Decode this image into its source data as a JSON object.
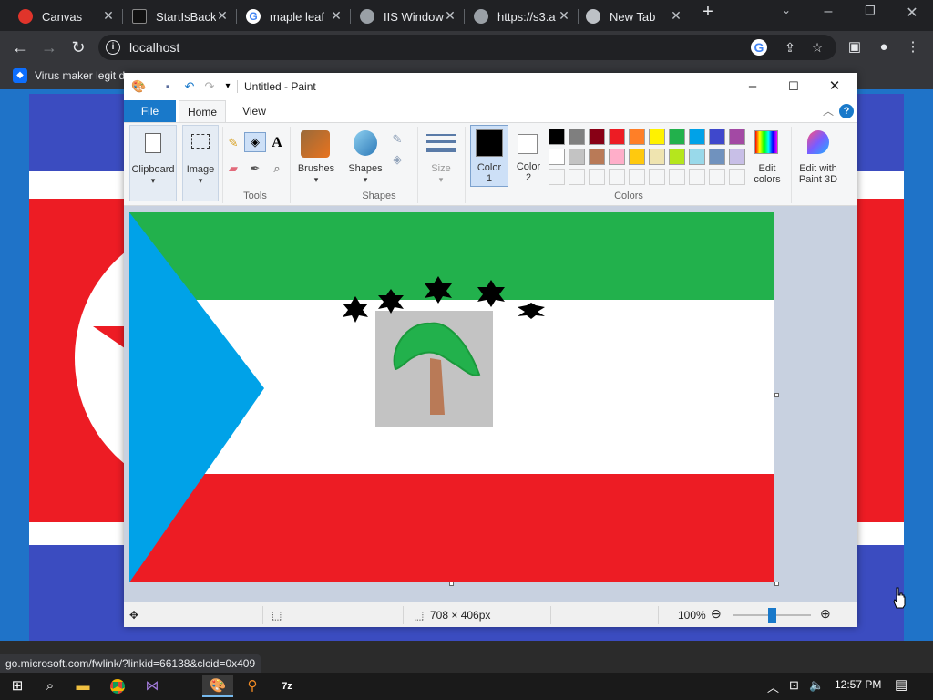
{
  "browser": {
    "tabs": [
      {
        "title": "Canvas",
        "icon": "canvas-icon"
      },
      {
        "title": "StartIsBack",
        "icon": "startisback-icon"
      },
      {
        "title": "maple leaf",
        "icon": "google-icon"
      },
      {
        "title": "IIS Window",
        "icon": "globe-icon"
      },
      {
        "title": "https://s3.a",
        "icon": "globe-icon"
      },
      {
        "title": "New Tab",
        "icon": "chrome-icon"
      }
    ],
    "new_tab": "+",
    "url": "localhost",
    "bookmark": "Virus maker legit d",
    "status_url": "go.microsoft.com/fwlink/?linkid=66138&clcid=0x409"
  },
  "paint": {
    "title": "Untitled - Paint",
    "tabs": {
      "file": "File",
      "home": "Home",
      "view": "View"
    },
    "ribbon": {
      "clipboard": "Clipboard",
      "image": "Image",
      "tools": "Tools",
      "brushes": "Brushes",
      "shapes": "Shapes",
      "shapes_group": "Shapes",
      "size": "Size",
      "color1": "Color",
      "color1_num": "1",
      "color2": "Color",
      "color2_num": "2",
      "colors": "Colors",
      "edit_colors_1": "Edit",
      "edit_colors_2": "colors",
      "edit_3d_1": "Edit with",
      "edit_3d_2": "Paint 3D"
    },
    "color1_value": "#000000",
    "color2_value": "#ffffff",
    "palette_row1": [
      "#000000",
      "#7f7f7f",
      "#880015",
      "#ed1c24",
      "#ff7f27",
      "#fff200",
      "#22b14c",
      "#00a2e8",
      "#3f48cc",
      "#a349a4"
    ],
    "palette_row2": [
      "#ffffff",
      "#c3c3c3",
      "#b97a57",
      "#ffaec9",
      "#ffc90e",
      "#efe4b0",
      "#b5e61d",
      "#99d9ea",
      "#7092be",
      "#c8bfe7"
    ],
    "status": {
      "dimensions": "708 × 406px",
      "zoom": "100%"
    }
  },
  "taskbar": {
    "time": "12:57 PM"
  }
}
